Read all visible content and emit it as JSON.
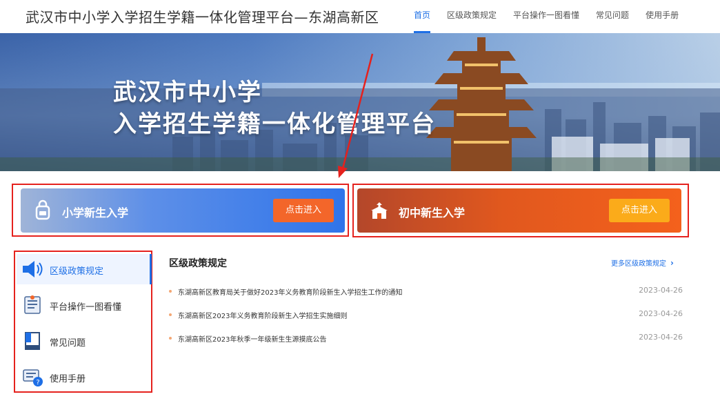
{
  "header": {
    "site_title": "武汉市中小学入学招生学籍一体化管理平台—东湖高新区",
    "nav": [
      {
        "label": "首页",
        "active": true
      },
      {
        "label": "区级政策规定",
        "active": false
      },
      {
        "label": "平台操作一图看懂",
        "active": false
      },
      {
        "label": "常见问题",
        "active": false
      },
      {
        "label": "使用手册",
        "active": false
      }
    ]
  },
  "banner": {
    "line1": "武汉市中小学",
    "line2": "入学招生学籍一体化管理平台"
  },
  "entries": {
    "primary": {
      "label": "小学新生入学",
      "button": "点击进入",
      "icon": "school-bag-icon"
    },
    "middle": {
      "label": "初中新生入学",
      "button": "点击进入",
      "icon": "school-building-icon"
    }
  },
  "sidebar": {
    "items": [
      {
        "label": "区级政策规定",
        "icon": "speaker-icon",
        "active": true
      },
      {
        "label": "平台操作一图看懂",
        "icon": "document-icon",
        "active": false
      },
      {
        "label": "常见问题",
        "icon": "book-icon",
        "active": false
      },
      {
        "label": "使用手册",
        "icon": "manual-help-icon",
        "active": false
      }
    ]
  },
  "policy": {
    "title": "区级政策规定",
    "more": "更多区级政策规定",
    "rows": [
      {
        "text": "东湖高新区教育局关于做好2023年义务教育阶段新生入学招生工作的通知",
        "date": "2023-04-26"
      },
      {
        "text": "东湖高新区2023年义务教育阶段新生入学招生实施细则",
        "date": "2023-04-26"
      },
      {
        "text": "东湖高新区2023年秋季一年级新生生源摸底公告",
        "date": "2023-04-26"
      }
    ]
  },
  "colors": {
    "accent": "#1e6fe6",
    "highlight_red": "#e5211d",
    "orange_button": "#f3662a",
    "yellow_button": "#fbab1a"
  }
}
